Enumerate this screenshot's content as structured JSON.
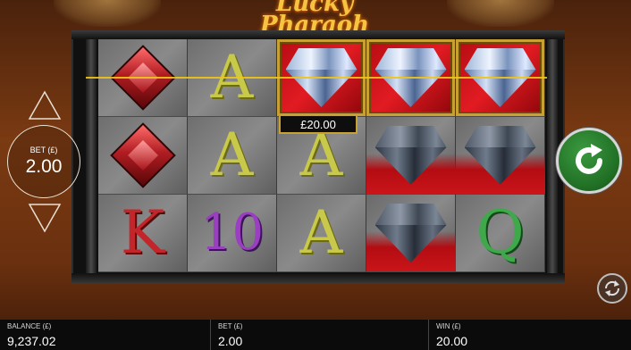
{
  "game": {
    "title": "Lucky Pharaoh"
  },
  "reels": {
    "symbols": [
      [
        "red-gem",
        "red-gem",
        "K"
      ],
      [
        "A",
        "A",
        "10"
      ],
      [
        "diamond",
        "A",
        "A"
      ],
      [
        "diamond",
        "diamond",
        "diamond"
      ],
      [
        "diamond",
        "diamond",
        "Q"
      ]
    ],
    "win_amount": "£20.00"
  },
  "bet_control": {
    "label": "BET (£)",
    "value": "2.00"
  },
  "bottom_bar": {
    "balance_label": "BALANCE (£)",
    "balance_value": "9,237.02",
    "bet_label": "BET (£)",
    "bet_value": "2.00",
    "win_label": "WIN (£)",
    "win_value": "20.00"
  },
  "icons": {
    "spin": "spin-arrow-icon",
    "autoplay": "autoplay-icon",
    "bet_up": "triangle-up-icon",
    "bet_down": "triangle-down-icon"
  },
  "colors": {
    "accent": "#f0c419",
    "spin": "#2a7f2e",
    "diamond_bg": "#c9151a"
  }
}
